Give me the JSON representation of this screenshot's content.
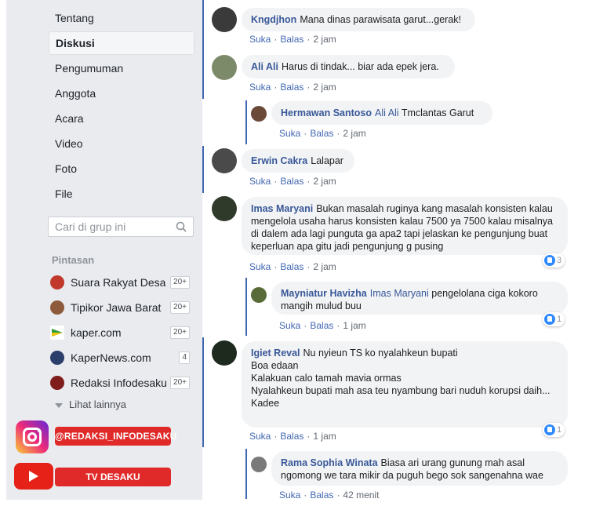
{
  "sidebar": {
    "nav": [
      {
        "label": "Tentang"
      },
      {
        "label": "Diskusi"
      },
      {
        "label": "Pengumuman"
      },
      {
        "label": "Anggota"
      },
      {
        "label": "Acara"
      },
      {
        "label": "Video"
      },
      {
        "label": "Foto"
      },
      {
        "label": "File"
      }
    ],
    "search_placeholder": "Cari di grup ini",
    "shortcuts_title": "Pintasan",
    "shortcuts": [
      {
        "label": "Suara Rakyat Desa",
        "count": "20+",
        "icon": "group-icon"
      },
      {
        "label": "Tipikor Jawa Barat",
        "count": "20+",
        "icon": "group-icon"
      },
      {
        "label": "kaper.com",
        "count": "20+",
        "icon": "group-icon"
      },
      {
        "label": "KaperNews.com",
        "count": "4",
        "icon": "group-icon"
      },
      {
        "label": "Redaksi Infodesaku",
        "count": "20+",
        "icon": "group-icon"
      }
    ],
    "see_more": "Lihat lainnya"
  },
  "overlay": {
    "instagram_handle": "@REDAKSI_INFODESAKU",
    "youtube_label": "TV DESAKU"
  },
  "actions": {
    "like": "Suka",
    "reply": "Balas"
  },
  "comments": [
    {
      "author": "Kngdjhon",
      "text": "Mana dinas parawisata garut...gerak!",
      "time": "2 jam"
    },
    {
      "author": "Ali Ali",
      "text": "Harus di tindak... biar ada epek jera.",
      "time": "2 jam"
    },
    {
      "author": "Hermawan Santoso",
      "mention": "Ali Ali",
      "text": "Tmclantas Garut",
      "time": "2 jam"
    },
    {
      "author": "Erwin Cakra",
      "text": "Lalapar",
      "time": "2 jam"
    },
    {
      "author": "Imas Maryani",
      "text": "Bukan masalah ruginya kang masalah konsisten kalau mengelola usaha harus konsisten kalau 7500 ya 7500 kalau misalnya di dalem ada lagi punguta ga apa2 tapi jelaskan ke pengunjung buat keperluan apa gitu jadi pengunjung g pusing",
      "time": "2 jam",
      "likes": "3"
    },
    {
      "author": "Mayniatur Havizha",
      "mention": "Imas Maryani",
      "text": "pengelolana ciga kokoro mangih mulud buu",
      "time": "1 jam",
      "likes": "1"
    },
    {
      "author": "Igiet Reval",
      "lines": [
        "Nu nyieun TS ko nyalahkeun bupati",
        "Boa edaan",
        "Kalakuan calo tamah mavia ormas",
        "Nyalahkeun bupati mah asa teu nyambung bari nuduh korupsi daih...",
        "Kadee"
      ],
      "time": "1 jam",
      "likes": "1"
    },
    {
      "author": "Rama Sophia Winata",
      "text": "Biasa ari urang gunung mah asal ngomong we tara mikir da puguh bego sok sangenahna wae",
      "time": "42 menit"
    }
  ]
}
